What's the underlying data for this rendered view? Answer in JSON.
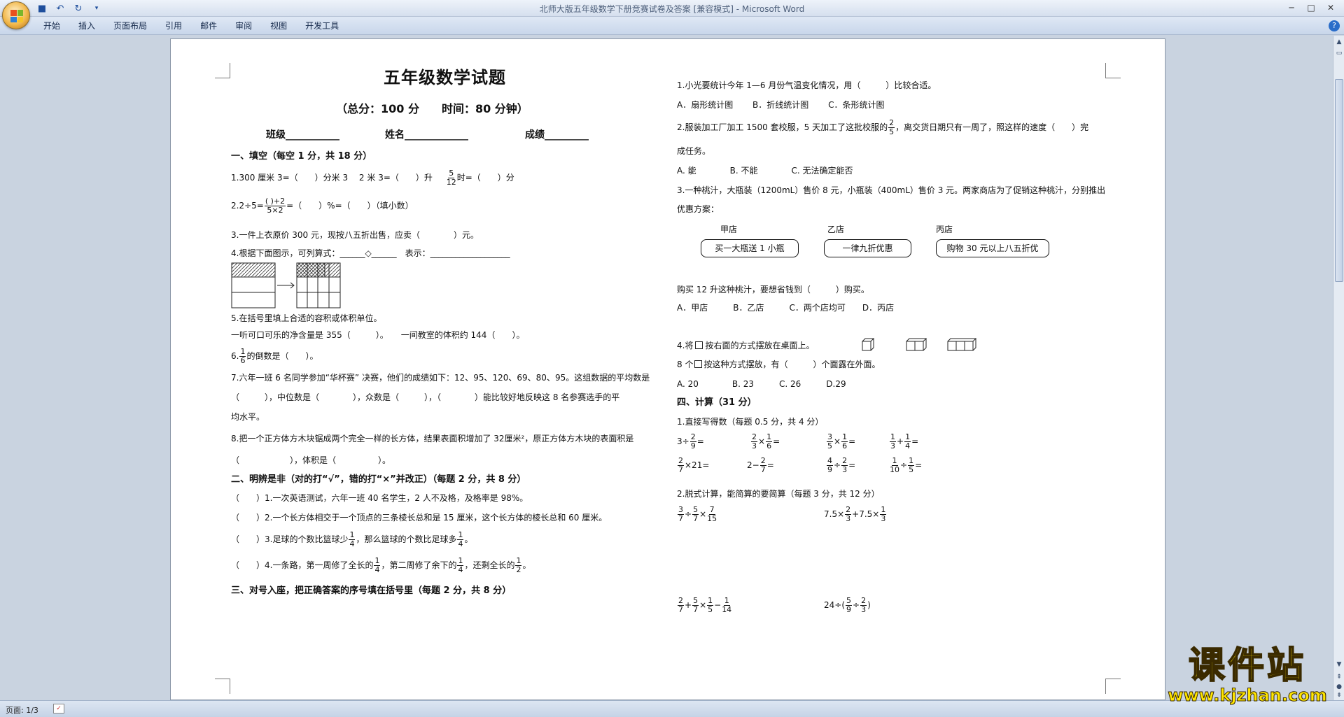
{
  "window": {
    "title": "北师大版五年级数学下册竞赛试卷及答案 [兼容模式] - Microsoft Word"
  },
  "ribbon": {
    "tabs": [
      "开始",
      "插入",
      "页面布局",
      "引用",
      "邮件",
      "审阅",
      "视图",
      "开发工具"
    ]
  },
  "status": {
    "page": "页面: 1/3"
  },
  "watermark": {
    "title": "课件站",
    "url": "www.kjzhan.com"
  },
  "colors": {
    "accent": "#2a6dc9",
    "watermark": "#f7e000"
  },
  "doc": {
    "title": "五年级数学试题",
    "subtitle": "（总分：100 分　　时间：80 分钟）",
    "info": {
      "class": "班级___________",
      "name": "姓名_____________",
      "score": "成绩_________"
    },
    "sec1": "一、填空（每空 1 分，共 18 分）",
    "q1a": "1.300 厘米 3=（　　）分米 3　 2 米 3=（　　）升",
    "q1b": "时=（　　）分",
    "q2a": "2.2÷5=",
    "q2b": "=（　　）%=（　　）（填小数）",
    "q3": "3.一件上衣原价 300 元，现按八五折出售，应卖（　　　　）元。",
    "q4": "4.根据下面图示，可列算式：______◇______　表示：___________________",
    "q5": "5.在括号里填上合适的容积或体积单位。",
    "q5a": "一听可口可乐的净含量是 355（　　　）。　　一间教室的体积约 144（　　）。",
    "q6a": "6.",
    "q6b": "的倒数是（　　）。",
    "q7a": "7.六年一班 6 名同学参加“华杯赛” 决赛，他们的成绩如下：12、95、120、69、80、95。这组数据的平均数是",
    "q7b": "（　　　），中位数是（　　　　），众数是（　　　），（　　　　）能比较好地反映这 8 名参赛选手的平",
    "q7c": "均水平。",
    "q8a": "8.把一个正方体方木块锯成两个完全一样的长方体，结果表面积增加了 32厘米²，原正方体方木块的表面积是",
    "q8b": "（　　　　　　），体积是（　　　　　）。",
    "sec2": "二、明辨是非（对的打“√”，错的打“×”并改正）（每题 2 分，共 8 分）",
    "j1": "（　　）1.一次英语测试，六年一班 40 名学生，2 人不及格，及格率是 98%。",
    "j2": "（　　）2.一个长方体相交于一个顶点的三条棱长总和是 15 厘米，这个长方体的棱长总和 60 厘米。",
    "j3a": "（　　）3.足球的个数比篮球少",
    "j3b": "，那么篮球的个数比足球多",
    "j3c": "。",
    "j4a": "（　　）4.一条路，第一周修了全长的",
    "j4b": "，第二周修了余下的",
    "j4c": "，还剩全长的",
    "j4d": "。",
    "sec3": "三、对号入座，把正确答案的序号填在括号里（每题 2 分，共 8 分）",
    "r1": "1.小光要统计今年 1—6 月份气温变化情况，用（　　　）比较合适。",
    "r1o": "A．扇形统计图　　 B．折线统计图　　 C．条形统计图",
    "r2a": "2.服装加工厂加工 1500 套校服，5 天加工了这批校服的",
    "r2b": "，离交货日期只有一周了，照这样的速度（　　）完",
    "r2c": "成任务。",
    "r2o": "A. 能　　　　B. 不能　　　　C. 无法确定能否",
    "r3a": "3.一种桃汁，大瓶装（1200mL）售价 8 元，小瓶装（400mL）售价 3 元。两家商店为了促销这种桃汁，分别推出",
    "r3b": "优惠方案：",
    "shops": [
      {
        "name": "甲店",
        "offer": "买一大瓶送 1 小瓶"
      },
      {
        "name": "乙店",
        "offer": "一律九折优惠"
      },
      {
        "name": "丙店",
        "offer": "购物 30 元以上八五折优"
      }
    ],
    "r3c": "购买 12 升这种桃汁，要想省钱到（　　　）购买。",
    "r3o": "A．甲店　　　B．乙店　　　C．两个店均可　　D．丙店",
    "r4a": "4.将",
    "r4b": "按右面的方式摆放在桌面上。",
    "r4c": "8 个",
    "r4d": "按这种方式摆放，有（　　　）个面露在外面。",
    "r4o": "A. 20　　　　B. 23　　　C. 26　　　D.29",
    "sec4": "四、计算（31 分）",
    "c1": "1.直接写得数（每题 0.5 分，共 4 分）",
    "c2": "2.脱式计算，能简算的要简算（每题 3 分，共 12 分）",
    "f": {
      "n5": "5",
      "d12": "12",
      "n1": "1",
      "d6": "6",
      "d4": "4",
      "d2": "2",
      "n2": "2",
      "d5": "5",
      "d9": "9",
      "d3": "3",
      "d7": "7",
      "n3": "3",
      "n4": "4",
      "d10": "10",
      "n7": "7",
      "d15": "15",
      "d14": "14",
      "frac_q2_num": "(  )+2",
      "frac_q2_den": "5×2"
    },
    "ops": {
      "three_div": "3÷",
      "eq": "=",
      "mul": "×",
      "plus": "+",
      "minus": "−",
      "div": "÷",
      "x21": "×21=",
      "two_minus": "2−",
      "s75a": "7.5×",
      "s75b": "+7.5×",
      "s24a": "24÷(",
      "s24b": ")"
    }
  }
}
